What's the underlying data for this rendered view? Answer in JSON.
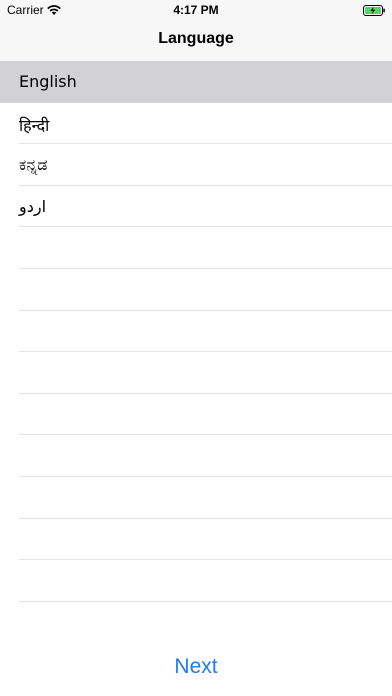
{
  "status_bar": {
    "carrier": "Carrier",
    "time": "4:17 PM",
    "wifi_icon": "wifi-icon",
    "battery_icon": "battery-charging-icon",
    "battery_color": "#4cd964"
  },
  "nav": {
    "title": "Language"
  },
  "languages": [
    {
      "label": "English",
      "selected": true
    },
    {
      "label": "हिन्दी",
      "selected": false
    },
    {
      "label": "ಕನ್ನಡ",
      "selected": false
    },
    {
      "label": "اردو",
      "selected": false
    },
    {
      "label": "",
      "selected": false
    },
    {
      "label": "",
      "selected": false
    },
    {
      "label": "",
      "selected": false
    },
    {
      "label": "",
      "selected": false
    },
    {
      "label": "",
      "selected": false
    },
    {
      "label": "",
      "selected": false
    },
    {
      "label": "",
      "selected": false
    },
    {
      "label": "",
      "selected": false
    },
    {
      "label": "",
      "selected": false
    }
  ],
  "footer": {
    "next_label": "Next"
  },
  "colors": {
    "accent": "#1a7cf5",
    "selected_row": "#d1d1d6",
    "separator": "#e3e3e6",
    "bar_background": "#f7f7f7"
  }
}
